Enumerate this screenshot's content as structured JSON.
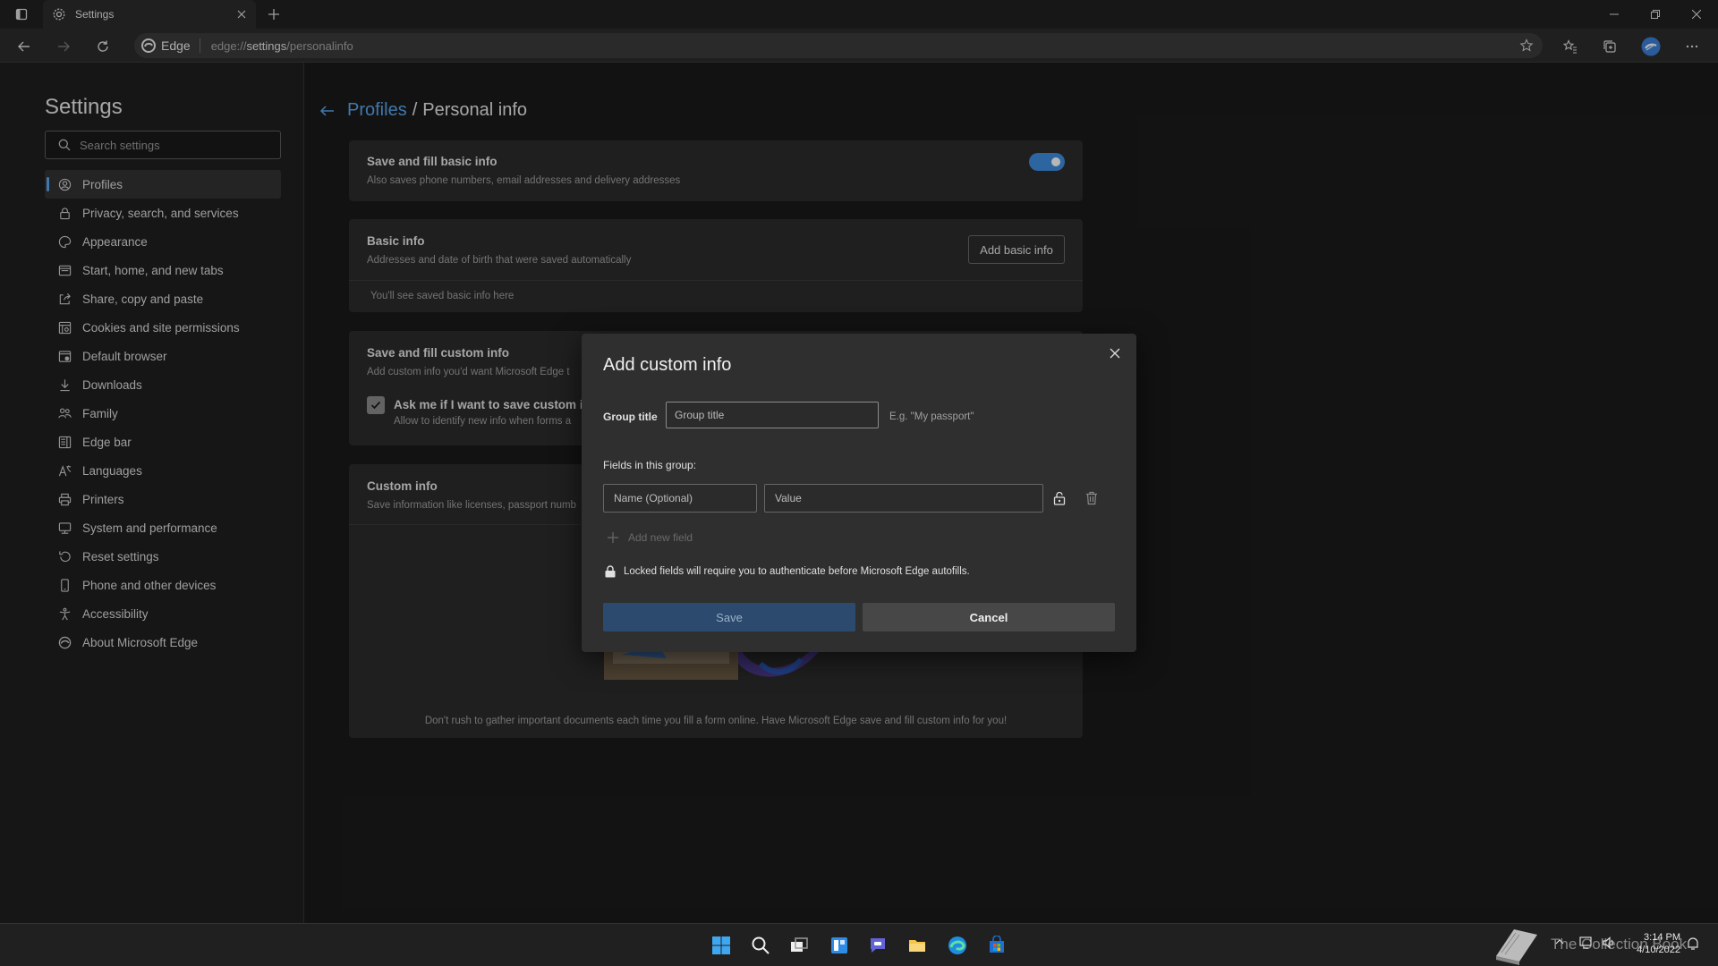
{
  "browser": {
    "tab_title": "Settings",
    "identity_label": "Edge",
    "url_prefix": "edge://",
    "url_bold": "settings",
    "url_suffix": "/personalinfo"
  },
  "sidebar": {
    "title": "Settings",
    "search_placeholder": "Search settings",
    "items": [
      {
        "label": "Profiles",
        "icon": "profile-icon",
        "active": true
      },
      {
        "label": "Privacy, search, and services",
        "icon": "lock-icon"
      },
      {
        "label": "Appearance",
        "icon": "appearance-icon"
      },
      {
        "label": "Start, home, and new tabs",
        "icon": "home-tabs-icon"
      },
      {
        "label": "Share, copy and paste",
        "icon": "share-icon"
      },
      {
        "label": "Cookies and site permissions",
        "icon": "cookies-icon"
      },
      {
        "label": "Default browser",
        "icon": "browser-icon"
      },
      {
        "label": "Downloads",
        "icon": "download-icon"
      },
      {
        "label": "Family",
        "icon": "family-icon"
      },
      {
        "label": "Edge bar",
        "icon": "edge-bar-icon"
      },
      {
        "label": "Languages",
        "icon": "languages-icon"
      },
      {
        "label": "Printers",
        "icon": "printer-icon"
      },
      {
        "label": "System and performance",
        "icon": "system-icon"
      },
      {
        "label": "Reset settings",
        "icon": "reset-icon"
      },
      {
        "label": "Phone and other devices",
        "icon": "phone-icon"
      },
      {
        "label": "Accessibility",
        "icon": "accessibility-icon"
      },
      {
        "label": "About Microsoft Edge",
        "icon": "edge-icon"
      }
    ]
  },
  "breadcrumb": {
    "parent": "Profiles",
    "separator": "/",
    "current": "Personal info"
  },
  "cards": {
    "save_basic": {
      "title": "Save and fill basic info",
      "subtitle": "Also saves phone numbers, email addresses and delivery addresses",
      "toggle_on": true
    },
    "basic_info": {
      "title": "Basic info",
      "subtitle": "Addresses and date of birth that were saved automatically",
      "button": "Add basic info",
      "empty_text": "You'll see saved basic info here"
    },
    "save_custom": {
      "title": "Save and fill custom info",
      "subtitle": "Add custom info you'd want Microsoft Edge t",
      "checkbox_label": "Ask me if I want to save custom i",
      "checkbox_sub": "Allow to identify new info when forms a",
      "checked": true
    },
    "custom_info": {
      "title": "Custom info",
      "subtitle": "Save information like licenses, passport numb",
      "footer": "Don't rush to gather important documents each time you fill a form online. Have Microsoft Edge save and fill custom info for you!"
    }
  },
  "dialog": {
    "title": "Add custom info",
    "group_label": "Group title",
    "group_placeholder": "Group title",
    "group_hint": "E.g. \"My passport\"",
    "fields_label": "Fields in this group:",
    "name_placeholder": "Name (Optional)",
    "value_placeholder": "Value",
    "add_field": "Add new field",
    "lock_note": "Locked fields will require you to authenticate before Microsoft Edge autofills.",
    "save": "Save",
    "cancel": "Cancel"
  },
  "taskbar": {
    "time": "3:14 PM",
    "date": "4/10/2022",
    "watermark": "The Collection Book"
  },
  "colors": {
    "accent": "#5aa7ef",
    "toggle": "#3f8de0",
    "save_button": "#2c4a6e"
  }
}
